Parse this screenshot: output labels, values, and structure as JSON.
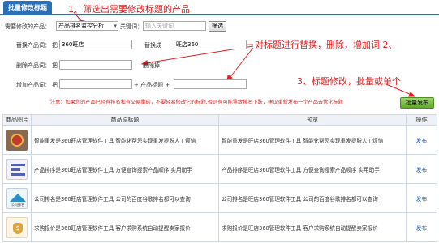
{
  "tab": {
    "label": "批量修改标题"
  },
  "annotations": {
    "step1": "1、筛选出需要修改标题的产品",
    "step2": "对标题进行替换，删除，增加词 2、",
    "step3": "3、标题修改，批量或单个"
  },
  "filter": {
    "product_label": "需要修改的产品：",
    "product_select": "产品排名监控分析",
    "keyword_label": "关键词：",
    "keyword_placeholder": "输入关键词",
    "filter_button": "筛选"
  },
  "replace": {
    "label": "替换产品词：",
    "from_prefix": "把",
    "from_value": "360旺店",
    "to_label": "替换成",
    "to_value": "旺店360"
  },
  "delete": {
    "label": "删除产品词：",
    "from_prefix": "把",
    "suffix": "删除掉"
  },
  "add": {
    "label": "增加产品词：",
    "from_prefix": "把",
    "middle": "+ 产品标题 +"
  },
  "notice": "注意：如果您的产品已经有排名和有交易量的，不要轻易修改它的标题,否则有可能导致排名下跌，建议重新发布一个产品去优化标题",
  "publish_button": "批量发布",
  "table": {
    "headers": [
      "商品图片",
      "商品原标题",
      "预览",
      "操作"
    ],
    "rows": [
      {
        "original": "智能重发是360旺店管理软件工具 智能化帮您实现重发提脱人工烦恼",
        "preview": "智能重发是旺店360管理软件工具 智能化帮您实现重发提脱人工烦恼",
        "action": "发布"
      },
      {
        "original": "产品排序是360旺店管理软件工具 方便查询搜索产品顺序 实用助手",
        "preview": "产品排序是旺店360管理软件工具 方便查询搜索产品顺序 实用助手",
        "action": "发布"
      },
      {
        "original": "公司排名是360旺店管理软件工具 公司的百度谷歌排名都可以查询",
        "preview": "公司排名是旺店360管理软件工具 公司的百度谷歌排名都可以查询",
        "action": "发布"
      },
      {
        "original": "求购报价是360旺店管理软件工具 客户求购系统自动提醒卖家报价",
        "preview": "求购报价是旺店360管理软件工具 客户求购系统自动提醒卖家报价",
        "action": "发布"
      }
    ],
    "thumb3_text": "公司排名"
  },
  "colors": {
    "accent": "#2d6fb6",
    "annotation": "#e02020",
    "publish": "#6fb83a"
  }
}
